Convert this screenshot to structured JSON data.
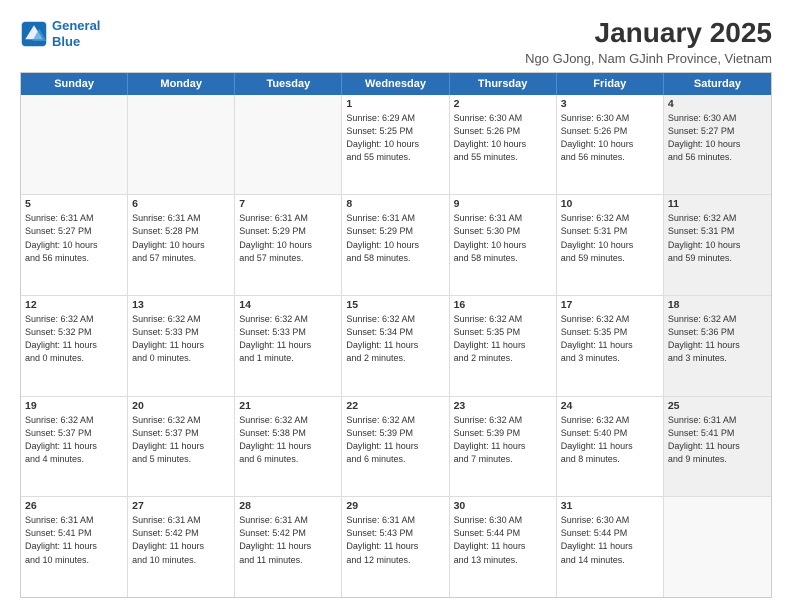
{
  "logo": {
    "line1": "General",
    "line2": "Blue"
  },
  "title": "January 2025",
  "subtitle": "Ngo GJong, Nam GJinh Province, Vietnam",
  "days": [
    "Sunday",
    "Monday",
    "Tuesday",
    "Wednesday",
    "Thursday",
    "Friday",
    "Saturday"
  ],
  "weeks": [
    [
      {
        "day": "",
        "text": ""
      },
      {
        "day": "",
        "text": ""
      },
      {
        "day": "",
        "text": ""
      },
      {
        "day": "1",
        "text": "Sunrise: 6:29 AM\nSunset: 5:25 PM\nDaylight: 10 hours\nand 55 minutes."
      },
      {
        "day": "2",
        "text": "Sunrise: 6:30 AM\nSunset: 5:26 PM\nDaylight: 10 hours\nand 55 minutes."
      },
      {
        "day": "3",
        "text": "Sunrise: 6:30 AM\nSunset: 5:26 PM\nDaylight: 10 hours\nand 56 minutes."
      },
      {
        "day": "4",
        "text": "Sunrise: 6:30 AM\nSunset: 5:27 PM\nDaylight: 10 hours\nand 56 minutes."
      }
    ],
    [
      {
        "day": "5",
        "text": "Sunrise: 6:31 AM\nSunset: 5:27 PM\nDaylight: 10 hours\nand 56 minutes."
      },
      {
        "day": "6",
        "text": "Sunrise: 6:31 AM\nSunset: 5:28 PM\nDaylight: 10 hours\nand 57 minutes."
      },
      {
        "day": "7",
        "text": "Sunrise: 6:31 AM\nSunset: 5:29 PM\nDaylight: 10 hours\nand 57 minutes."
      },
      {
        "day": "8",
        "text": "Sunrise: 6:31 AM\nSunset: 5:29 PM\nDaylight: 10 hours\nand 58 minutes."
      },
      {
        "day": "9",
        "text": "Sunrise: 6:31 AM\nSunset: 5:30 PM\nDaylight: 10 hours\nand 58 minutes."
      },
      {
        "day": "10",
        "text": "Sunrise: 6:32 AM\nSunset: 5:31 PM\nDaylight: 10 hours\nand 59 minutes."
      },
      {
        "day": "11",
        "text": "Sunrise: 6:32 AM\nSunset: 5:31 PM\nDaylight: 10 hours\nand 59 minutes."
      }
    ],
    [
      {
        "day": "12",
        "text": "Sunrise: 6:32 AM\nSunset: 5:32 PM\nDaylight: 11 hours\nand 0 minutes."
      },
      {
        "day": "13",
        "text": "Sunrise: 6:32 AM\nSunset: 5:33 PM\nDaylight: 11 hours\nand 0 minutes."
      },
      {
        "day": "14",
        "text": "Sunrise: 6:32 AM\nSunset: 5:33 PM\nDaylight: 11 hours\nand 1 minute."
      },
      {
        "day": "15",
        "text": "Sunrise: 6:32 AM\nSunset: 5:34 PM\nDaylight: 11 hours\nand 2 minutes."
      },
      {
        "day": "16",
        "text": "Sunrise: 6:32 AM\nSunset: 5:35 PM\nDaylight: 11 hours\nand 2 minutes."
      },
      {
        "day": "17",
        "text": "Sunrise: 6:32 AM\nSunset: 5:35 PM\nDaylight: 11 hours\nand 3 minutes."
      },
      {
        "day": "18",
        "text": "Sunrise: 6:32 AM\nSunset: 5:36 PM\nDaylight: 11 hours\nand 3 minutes."
      }
    ],
    [
      {
        "day": "19",
        "text": "Sunrise: 6:32 AM\nSunset: 5:37 PM\nDaylight: 11 hours\nand 4 minutes."
      },
      {
        "day": "20",
        "text": "Sunrise: 6:32 AM\nSunset: 5:37 PM\nDaylight: 11 hours\nand 5 minutes."
      },
      {
        "day": "21",
        "text": "Sunrise: 6:32 AM\nSunset: 5:38 PM\nDaylight: 11 hours\nand 6 minutes."
      },
      {
        "day": "22",
        "text": "Sunrise: 6:32 AM\nSunset: 5:39 PM\nDaylight: 11 hours\nand 6 minutes."
      },
      {
        "day": "23",
        "text": "Sunrise: 6:32 AM\nSunset: 5:39 PM\nDaylight: 11 hours\nand 7 minutes."
      },
      {
        "day": "24",
        "text": "Sunrise: 6:32 AM\nSunset: 5:40 PM\nDaylight: 11 hours\nand 8 minutes."
      },
      {
        "day": "25",
        "text": "Sunrise: 6:31 AM\nSunset: 5:41 PM\nDaylight: 11 hours\nand 9 minutes."
      }
    ],
    [
      {
        "day": "26",
        "text": "Sunrise: 6:31 AM\nSunset: 5:41 PM\nDaylight: 11 hours\nand 10 minutes."
      },
      {
        "day": "27",
        "text": "Sunrise: 6:31 AM\nSunset: 5:42 PM\nDaylight: 11 hours\nand 10 minutes."
      },
      {
        "day": "28",
        "text": "Sunrise: 6:31 AM\nSunset: 5:42 PM\nDaylight: 11 hours\nand 11 minutes."
      },
      {
        "day": "29",
        "text": "Sunrise: 6:31 AM\nSunset: 5:43 PM\nDaylight: 11 hours\nand 12 minutes."
      },
      {
        "day": "30",
        "text": "Sunrise: 6:30 AM\nSunset: 5:44 PM\nDaylight: 11 hours\nand 13 minutes."
      },
      {
        "day": "31",
        "text": "Sunrise: 6:30 AM\nSunset: 5:44 PM\nDaylight: 11 hours\nand 14 minutes."
      },
      {
        "day": "",
        "text": ""
      }
    ]
  ]
}
